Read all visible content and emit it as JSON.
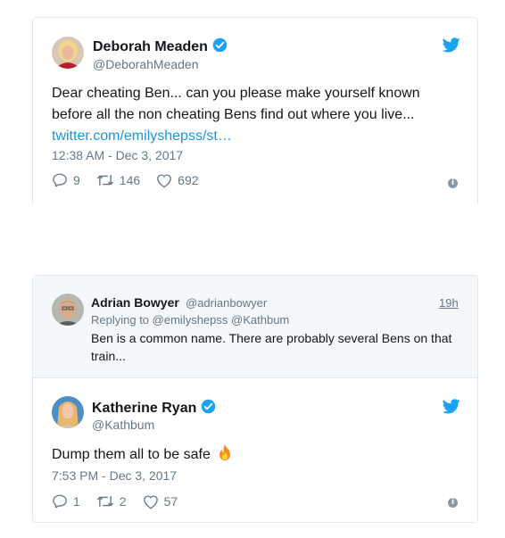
{
  "tweet1": {
    "name": "Deborah Meaden",
    "handle": "@DeborahMeaden",
    "text_line1": "Dear cheating Ben... can you please make yourself known",
    "text_line2": "before all the non cheating Bens find out where you live...",
    "link": "twitter.com/emilyshepss/st…",
    "timestamp": "12:38 AM - Dec 3, 2017",
    "replies": "9",
    "retweets": "146",
    "likes": "692",
    "verified": true,
    "avatar_icon": "user-avatar"
  },
  "reply": {
    "name": "Adrian Bowyer",
    "handle": "@adrianbowyer",
    "time": "19h",
    "replying_prefix": "Replying to",
    "replying_to_1": "@emilyshepss",
    "replying_to_2": "@Kathbum",
    "text_line1": "Ben is a common name. There are probably several Bens on that",
    "text_line2": "train..."
  },
  "tweet2": {
    "name": "Katherine Ryan",
    "handle": "@Kathbum",
    "text": "Dump them all to be safe",
    "emoji": "fire-emoji",
    "timestamp": "7:53 PM - Dec 3, 2017",
    "replies": "1",
    "retweets": "2",
    "likes": "57",
    "verified": true
  },
  "colors": {
    "twitter_blue": "#1da1f2",
    "link": "#1b95e0",
    "muted": "#657786",
    "border": "#e1e8ed",
    "reply_bg": "#f5f8fa"
  }
}
